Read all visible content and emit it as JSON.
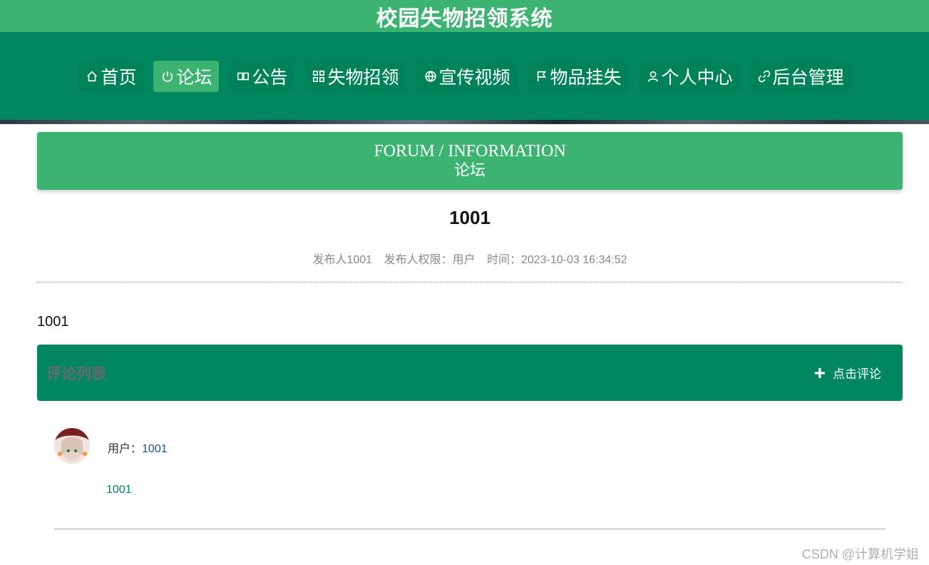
{
  "site": {
    "title": "校园失物招领系统"
  },
  "nav": {
    "items": [
      {
        "label": "首页",
        "icon": "home-icon",
        "active": false
      },
      {
        "label": "论坛",
        "icon": "power-icon",
        "active": true
      },
      {
        "label": "公告",
        "icon": "book-icon",
        "active": false
      },
      {
        "label": "失物招领",
        "icon": "grid-icon",
        "active": false
      },
      {
        "label": "宣传视频",
        "icon": "globe-icon",
        "active": false
      },
      {
        "label": "物品挂失",
        "icon": "flag-icon",
        "active": false
      },
      {
        "label": "个人中心",
        "icon": "user-icon",
        "active": false
      },
      {
        "label": "后台管理",
        "icon": "link-icon",
        "active": false
      }
    ]
  },
  "section": {
    "title_en": "FORUM / INFORMATION",
    "title_cn": "论坛"
  },
  "post": {
    "title": "1001",
    "author": "发布人1001",
    "permission": "发布人权限：用户",
    "time": "时间：2023-10-03 16:34:52",
    "content": "1001"
  },
  "comments": {
    "title": "评论列表",
    "add_label": "点击评论",
    "items": [
      {
        "user_label": "用户：",
        "user_id": "1001",
        "text": "1001"
      }
    ]
  },
  "watermark": "CSDN @计算机学姐",
  "colors": {
    "primary": "#00875f",
    "accent": "#3cb371"
  }
}
